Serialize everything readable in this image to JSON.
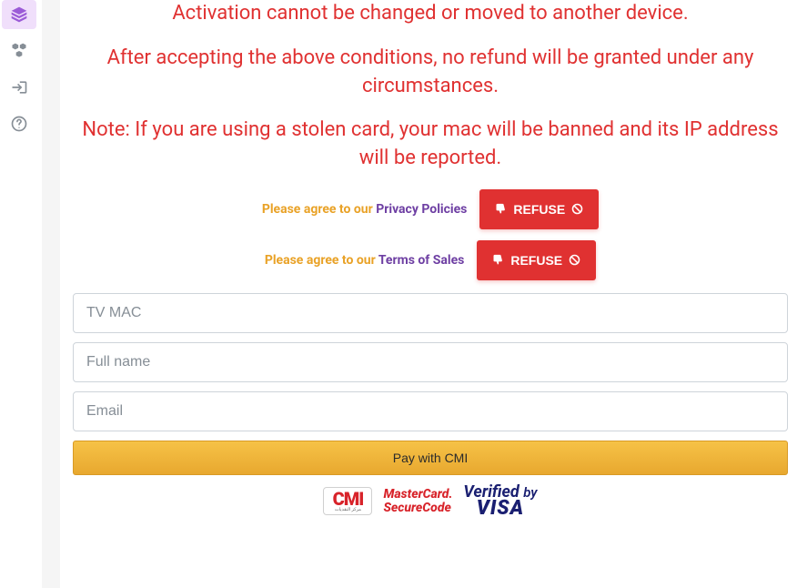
{
  "sidebar": {
    "items": [
      {
        "name": "nav-item-plans",
        "icon": "layers-icon",
        "active": true
      },
      {
        "name": "nav-item-devices",
        "icon": "boxes-icon",
        "active": false
      },
      {
        "name": "nav-item-login",
        "icon": "signin-icon",
        "active": false
      },
      {
        "name": "nav-item-help",
        "icon": "question-icon",
        "active": false
      }
    ]
  },
  "warnings": {
    "w1": "Activation cannot be changed or moved to another device.",
    "w2": "After accepting the above conditions, no refund will be granted under any circumstances.",
    "w3": "Note: If you are using a stolen card, your mac will be banned and its IP address will be reported."
  },
  "agreements": {
    "prefix": "Please agree to our ",
    "privacy_link": "Privacy Policies",
    "terms_link": "Terms of Sales",
    "refuse_label": "REFUSE"
  },
  "form": {
    "mac_placeholder": "TV MAC",
    "name_placeholder": "Full name",
    "email_placeholder": "Email",
    "pay_label": "Pay with CMI"
  },
  "badges": {
    "cmi_main": "CMI",
    "cmi_sub": "مركز النقديات",
    "mc_line1": "MasterCard",
    "mc_line2": "SecureCode",
    "visa_line1_a": "Verified",
    "visa_line1_b": "by",
    "visa_line2": "VISA"
  }
}
